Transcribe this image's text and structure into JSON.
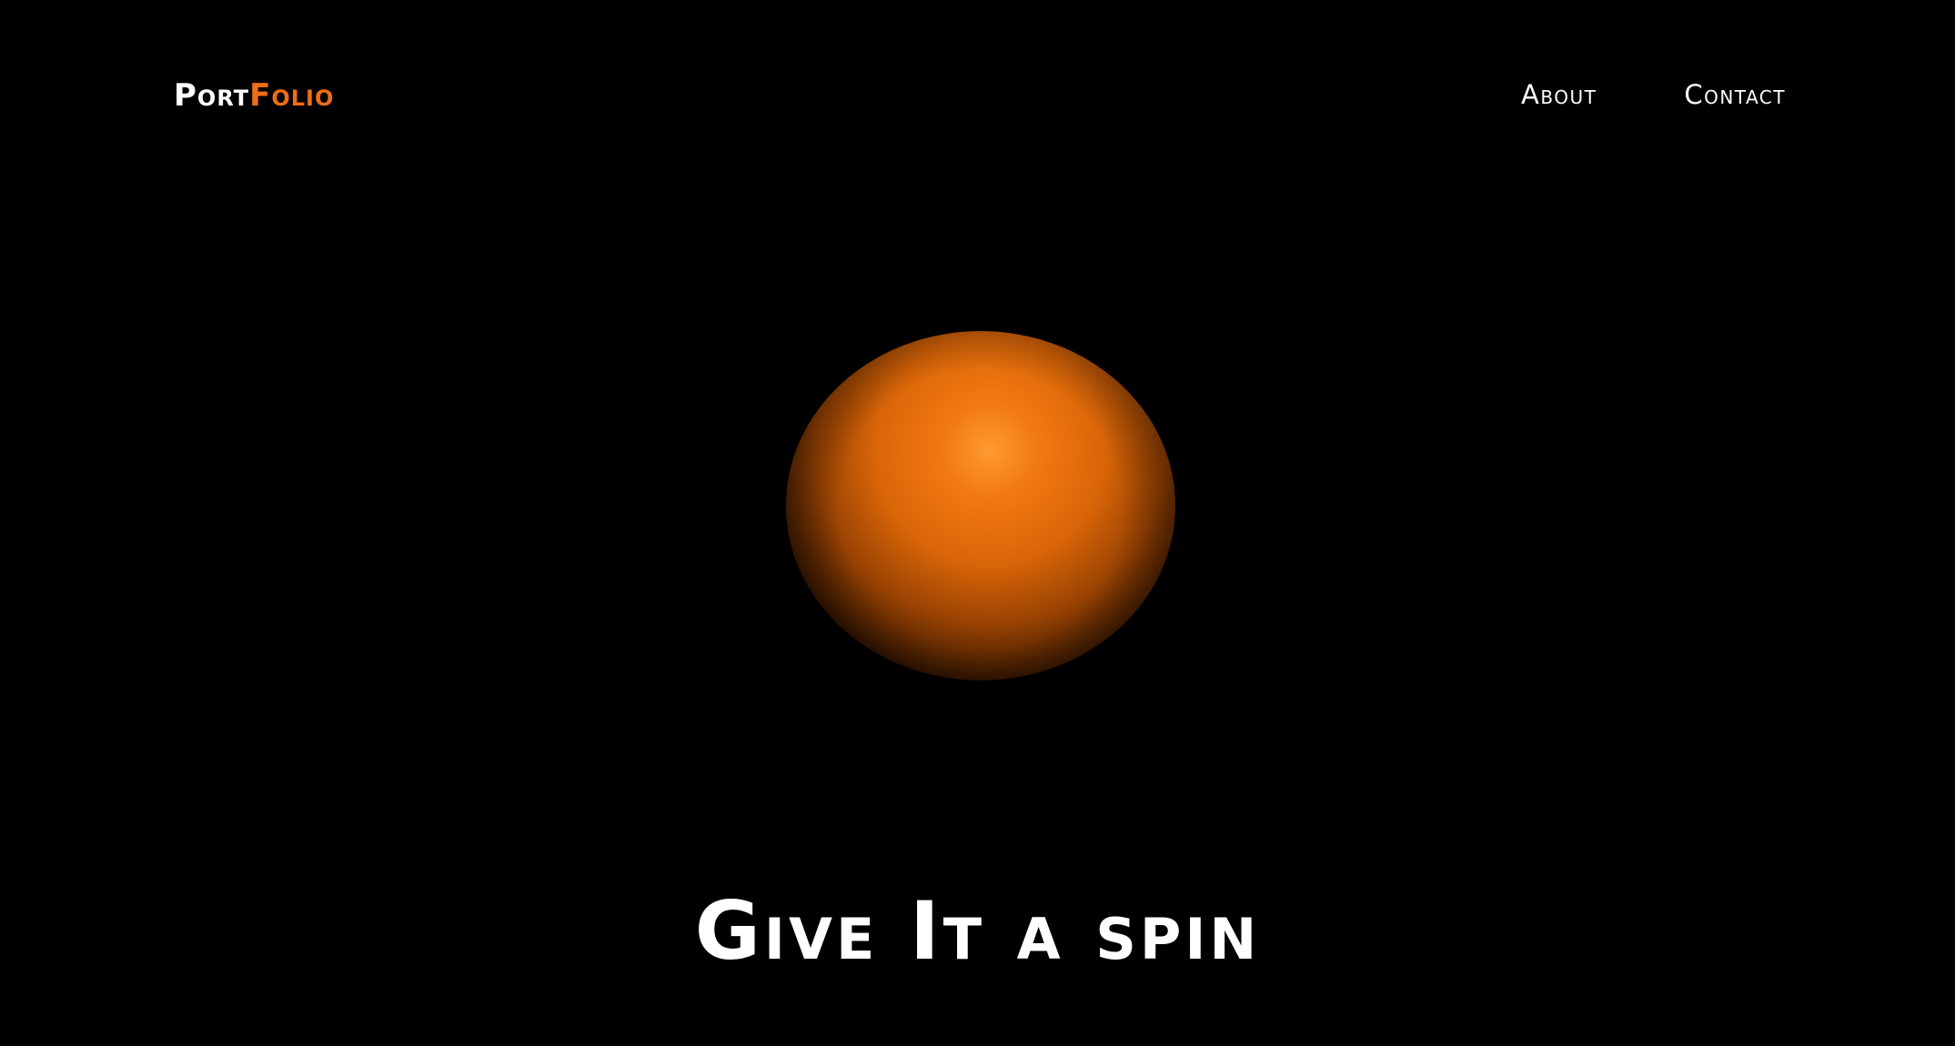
{
  "nav": {
    "logo_part_1": "Port",
    "logo_part_2": "Folio",
    "links": [
      {
        "label": "About"
      },
      {
        "label": "Contact"
      }
    ]
  },
  "hero": {
    "headline": "Give It a spin"
  },
  "colors": {
    "background": "#000000",
    "accent": "#ee6d16",
    "sphere_highlight": "#ff9a33",
    "text": "#ffffff"
  },
  "icons": {
    "sphere": "orange-3d-sphere"
  }
}
